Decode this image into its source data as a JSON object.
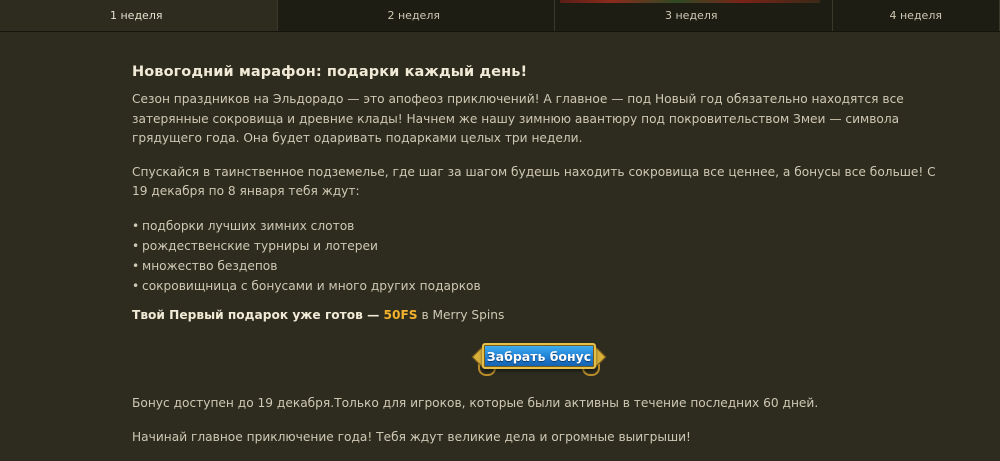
{
  "tabs": [
    {
      "label": "1 неделя",
      "active": true
    },
    {
      "label": "2 неделя",
      "active": false
    },
    {
      "label": "3 неделя",
      "active": false
    },
    {
      "label": "4 неделя",
      "active": false
    }
  ],
  "article": {
    "title": "Новогодний марафон: подарки каждый день!",
    "para1": "Сезон праздников на Эльдорадо — это апофеоз приключений! А главное — под Новый год обязательно находятся все затерянные сокровища и древние клады! Начнем же нашу зимнюю авантюру под покровительством Змеи — символа грядущего года. Она будет одаривать подарками целых три недели.",
    "para2": "Спускайся в таинственное подземелье, где шаг за шагом будешь находить сокровища все ценнее, а бонусы все больше! С 19 декабря по 8 января тебя ждут:",
    "bullet_char": "•",
    "list": [
      "подборки лучших зимних слотов",
      "рождественские турниры и лотереи",
      "множество бездепов",
      "сокровищница с бонусами и много других подарков"
    ],
    "gift_prefix": "Твой Первый подарок уже готов — ",
    "gift_amount": "50FS",
    "gift_suffix": " в Merry Spins",
    "button_label": "Забрать бонус",
    "note": "Бонус доступен до 19 декабря.Только для игроков, которые были активны в течение последних 60 дней.",
    "closing": "Начинай главное приключение года! Тебя ждут великие дела и огромные выигрыши!"
  },
  "colors": {
    "background": "#2d2c1f",
    "tab_bar": "#1e1d14",
    "accent_gold": "#f2b12c",
    "button_blue": "#1f7fd3"
  }
}
